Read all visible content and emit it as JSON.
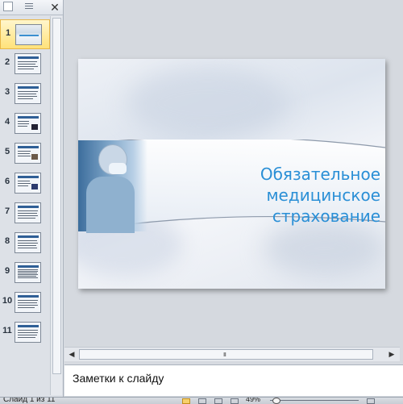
{
  "panel": {
    "close_glyph": "✕",
    "slides": [
      {
        "number": "1",
        "selected": true,
        "kind": "title"
      },
      {
        "number": "2",
        "kind": "text"
      },
      {
        "number": "3",
        "kind": "text"
      },
      {
        "number": "4",
        "kind": "image"
      },
      {
        "number": "5",
        "kind": "image"
      },
      {
        "number": "6",
        "kind": "image"
      },
      {
        "number": "7",
        "kind": "text"
      },
      {
        "number": "8",
        "kind": "text"
      },
      {
        "number": "9",
        "kind": "text"
      },
      {
        "number": "10",
        "kind": "text"
      },
      {
        "number": "11",
        "kind": "text"
      }
    ]
  },
  "slide": {
    "title_line1": "Обязательное медицинское",
    "title_line2": "страхование",
    "title_color": "#2a8fd6"
  },
  "scrollbar": {
    "left_arrow": "◀",
    "right_arrow": "▶",
    "grip": "III"
  },
  "notes": {
    "placeholder": "Заметки к слайду"
  },
  "status": {
    "slide_info": "Слайд 1 из 11",
    "zoom": "49%"
  },
  "colors": {
    "accent": "#2a8fd6",
    "selected_thumb": "#ffe27a"
  }
}
